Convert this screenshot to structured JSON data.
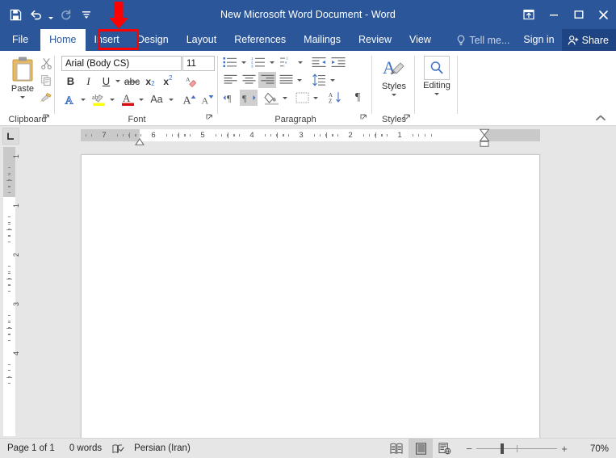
{
  "window": {
    "title": "New Microsoft Word Document - Word",
    "accent_color": "#2b579a",
    "share_bg_color": "#1e4484",
    "annotation_color": "#ff0000"
  },
  "quick_access": {
    "save_label": "Save",
    "undo_label": "Undo",
    "redo_label": "Redo",
    "customize_label": "Customize Quick Access Toolbar"
  },
  "window_controls": {
    "ribbon_display_label": "Ribbon Display Options",
    "minimize_label": "Minimize",
    "restore_label": "Restore Down",
    "close_label": "Close"
  },
  "tabs": [
    {
      "label": "File",
      "active": false
    },
    {
      "label": "Home",
      "active": true
    },
    {
      "label": "Insert",
      "active": false
    },
    {
      "label": "Design",
      "active": false
    },
    {
      "label": "Layout",
      "active": false
    },
    {
      "label": "References",
      "active": false
    },
    {
      "label": "Mailings",
      "active": false
    },
    {
      "label": "Review",
      "active": false
    },
    {
      "label": "View",
      "active": false
    }
  ],
  "right_commands": {
    "tell_me": "Tell me...",
    "sign_in": "Sign in",
    "share": "Share"
  },
  "annotation": {
    "target_tab": "Insert",
    "shape": "down-arrow",
    "color": "#ff0000"
  },
  "ribbon": {
    "collapse_label": "Collapse the Ribbon",
    "groups": [
      {
        "name": "Clipboard",
        "label": "Clipboard",
        "paste_label": "Paste",
        "buttons": [
          "Cut",
          "Copy",
          "Format Painter"
        ],
        "has_dialog_launcher": true
      },
      {
        "name": "Font",
        "label": "Font",
        "font_name": "Arial (Body CS)",
        "font_size": "11",
        "buttons": [
          "Bold",
          "Italic",
          "Underline",
          "Strikethrough",
          "Subscript",
          "Superscript",
          "Clear All Formatting",
          "Text Effects and Typography",
          "Text Highlight Color",
          "Font Color",
          "Change Case",
          "Increase Font Size",
          "Decrease Font Size"
        ],
        "has_dialog_launcher": true
      },
      {
        "name": "Paragraph",
        "label": "Paragraph",
        "buttons": [
          "Bullets",
          "Numbering",
          "Multilevel List",
          "Increase Indent",
          "Decrease Indent",
          "Align Left",
          "Center",
          "Align Right",
          "Justify",
          "Line and Paragraph Spacing",
          "Left-to-Right Text Direction",
          "Right-to-Left Text Direction",
          "Shading",
          "Borders",
          "Sort",
          "Show/Hide Formatting Marks"
        ],
        "has_dialog_launcher": true
      },
      {
        "name": "Styles",
        "label": "Styles",
        "button_label": "Styles",
        "has_dialog_launcher": true
      },
      {
        "name": "Editing",
        "label": "",
        "button_label": "Editing",
        "has_dialog_launcher": false
      }
    ]
  },
  "ruler": {
    "tab_stop_selector": "Left Tab",
    "direction": "rtl",
    "horizontal_numbers": [
      "7",
      "6",
      "5",
      "4",
      "3",
      "2",
      "1"
    ],
    "vertical_numbers": [
      "1",
      "1",
      "2",
      "3",
      "4"
    ],
    "unit": "inch"
  },
  "document": {
    "page_content": "",
    "background": "#ffffff"
  },
  "status_bar": {
    "page_info": "Page 1 of 1",
    "word_count": "0 words",
    "proofing_label": "Proofing errors",
    "language": "Persian (Iran)",
    "view_read_mode": "Read Mode",
    "view_print_layout": "Print Layout",
    "view_web_layout": "Web Layout",
    "active_view": "Print Layout",
    "zoom_out_label": "Zoom Out",
    "zoom_in_label": "Zoom In",
    "zoom_level": "70%",
    "zoom_value": 70
  }
}
